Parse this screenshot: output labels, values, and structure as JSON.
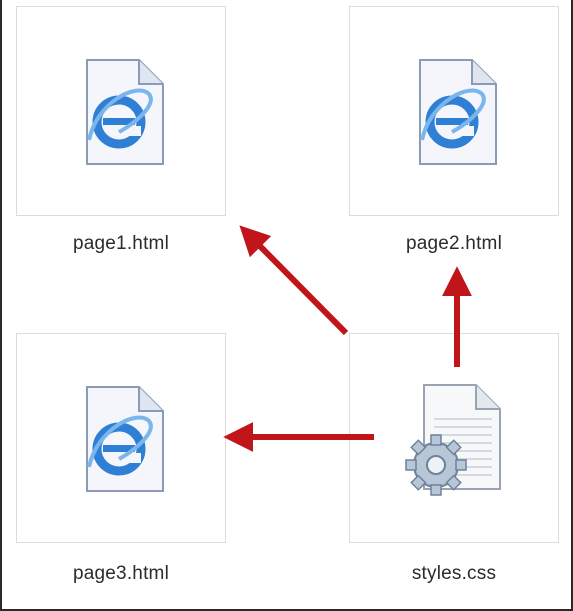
{
  "files": [
    {
      "name": "page1.html",
      "icon": "ie-html-file-icon"
    },
    {
      "name": "page2.html",
      "icon": "ie-html-file-icon"
    },
    {
      "name": "page3.html",
      "icon": "ie-html-file-icon"
    },
    {
      "name": "styles.css",
      "icon": "css-gear-file-icon"
    }
  ],
  "colors": {
    "arrow": "#c0151b",
    "tile_border": "#dcdcdc",
    "ie_blue": "#2f7fd4"
  }
}
